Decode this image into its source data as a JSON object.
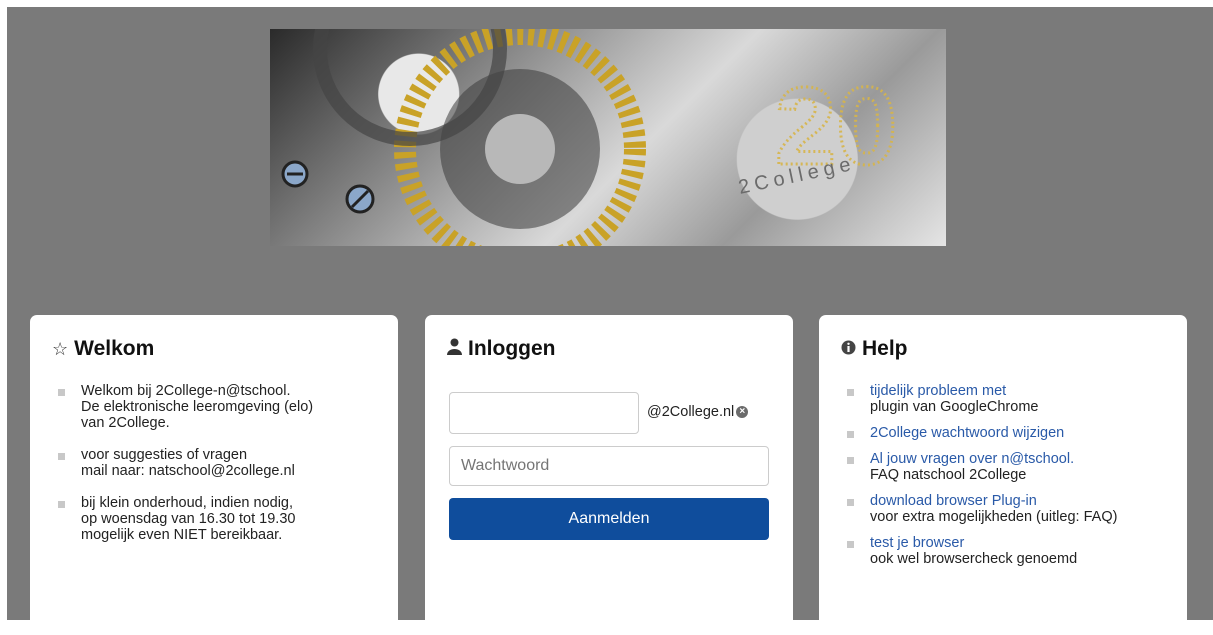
{
  "banner": {
    "alt_text": "2College"
  },
  "welkom": {
    "title": "Welkom",
    "items": [
      {
        "lines": [
          "Welkom bij 2College-n@tschool.",
          "De elektronische leeromgeving (elo)",
          "van 2College."
        ]
      },
      {
        "lines": [
          "voor suggesties of vragen",
          "mail naar: natschool@2college.nl"
        ]
      },
      {
        "lines": [
          "bij klein onderhoud, indien nodig,",
          "op woensdag van 16.30 tot 19.30",
          "mogelijk even NIET bereikbaar."
        ]
      }
    ]
  },
  "login": {
    "title": "Inloggen",
    "username_value": "",
    "username_suffix": "@2College.nl",
    "password_placeholder": "Wachtwoord",
    "submit_label": "Aanmelden"
  },
  "help": {
    "title": "Help",
    "items": [
      {
        "link": "tijdelijk probleem met",
        "text": "plugin van GoogleChrome"
      },
      {
        "link": "2College wachtwoord wijzigen",
        "text": ""
      },
      {
        "link": "Al jouw vragen over n@tschool.",
        "text": "FAQ natschool 2College"
      },
      {
        "link": "download browser Plug-in",
        "text": "voor extra mogelijkheden (uitleg: FAQ)"
      },
      {
        "link": "test je browser",
        "text": "ook wel browsercheck genoemd"
      }
    ]
  },
  "colors": {
    "background": "#7a7a7a",
    "button": "#0f4d9c",
    "link": "#2a5aa8"
  },
  "icons": [
    "star-icon",
    "user-icon",
    "info-icon",
    "clear-icon"
  ]
}
